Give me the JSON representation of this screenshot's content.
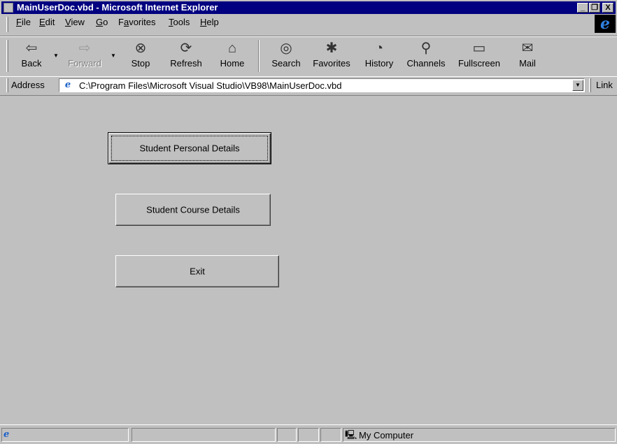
{
  "window": {
    "title": "MainUserDoc.vbd - Microsoft Internet Explorer",
    "controls": [
      "_",
      "❐",
      "X"
    ]
  },
  "menu": [
    "File",
    "Edit",
    "View",
    "Go",
    "Favorites",
    "Tools",
    "Help"
  ],
  "menu_accel": [
    "F",
    "E",
    "V",
    "G",
    "a",
    "T",
    "H"
  ],
  "toolbar": [
    {
      "label": "Back",
      "icon": "back-arrow-icon",
      "enabled": true
    },
    {
      "label": "Forward",
      "icon": "forward-arrow-icon",
      "enabled": false
    },
    {
      "label": "Stop",
      "icon": "stop-icon",
      "enabled": true
    },
    {
      "label": "Refresh",
      "icon": "refresh-icon",
      "enabled": true
    },
    {
      "label": "Home",
      "icon": "home-icon",
      "enabled": true
    },
    {
      "label": "Search",
      "icon": "search-icon",
      "enabled": true
    },
    {
      "label": "Favorites",
      "icon": "favorites-icon",
      "enabled": true
    },
    {
      "label": "History",
      "icon": "history-icon",
      "enabled": true
    },
    {
      "label": "Channels",
      "icon": "channels-icon",
      "enabled": true
    },
    {
      "label": "Fullscreen",
      "icon": "fullscreen-icon",
      "enabled": true
    },
    {
      "label": "Mail",
      "icon": "mail-icon",
      "enabled": true
    }
  ],
  "address": {
    "label": "Address",
    "value": "C:\\Program Files\\Microsoft Visual Studio\\VB98\\MainUserDoc.vbd",
    "links_label": "Link"
  },
  "form": {
    "buttons": [
      "Student Personal Details",
      "Student Course Details",
      "Exit"
    ]
  },
  "status": {
    "zone": "My Computer"
  }
}
